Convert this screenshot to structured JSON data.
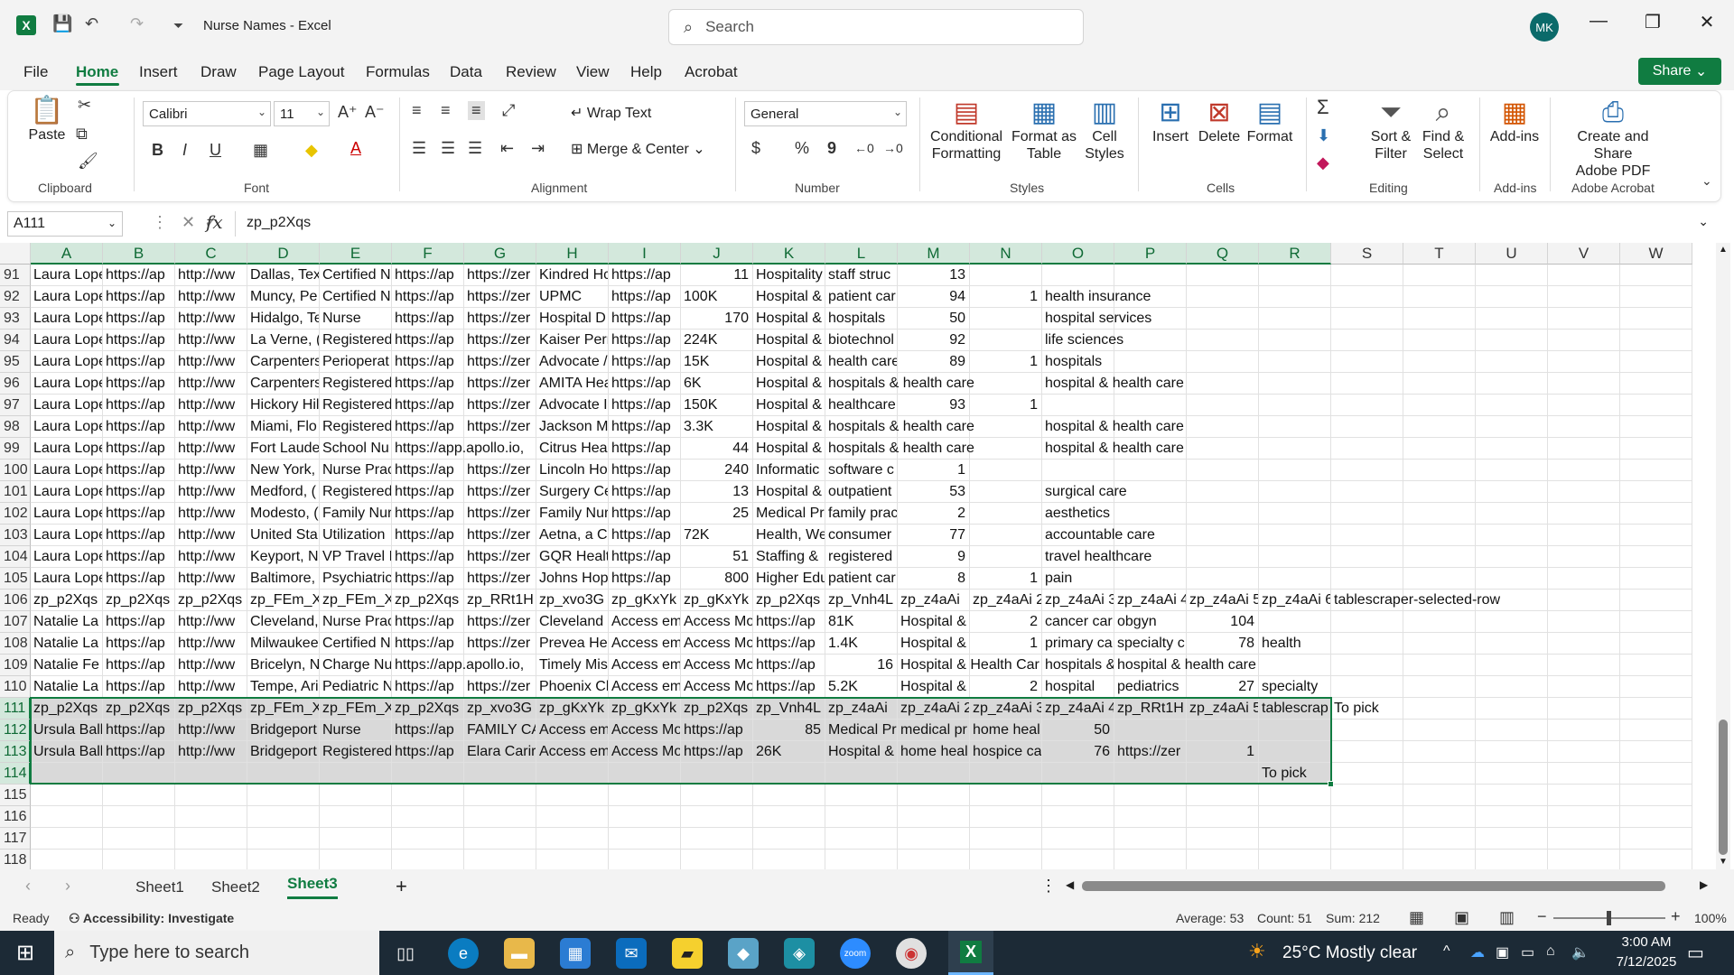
{
  "window": {
    "title": "Nurse Names  -  Excel",
    "search_placeholder": "Search",
    "user_initials": "MK",
    "minimize": "—",
    "restore": "❐",
    "close": "✕"
  },
  "menu": [
    "File",
    "Home",
    "Insert",
    "Draw",
    "Page Layout",
    "Formulas",
    "Data",
    "Review",
    "View",
    "Help",
    "Acrobat"
  ],
  "share_label": "Share",
  "ribbon": {
    "clipboard": {
      "paste": "Paste",
      "group": "Clipboard"
    },
    "font": {
      "name": "Calibri",
      "size": "11",
      "group": "Font",
      "bold": "B",
      "italic": "I",
      "underline": "U"
    },
    "alignment": {
      "wrap": "Wrap Text",
      "merge": "Merge & Center",
      "group": "Alignment"
    },
    "number": {
      "format": "General",
      "group": "Number",
      "currency": "$",
      "percent": "%",
      "comma": "9"
    },
    "styles": {
      "conditional": "Conditional\nFormatting",
      "format_table": "Format as\nTable",
      "cell_styles": "Cell\nStyles",
      "group": "Styles"
    },
    "cells": {
      "insert": "Insert",
      "delete": "Delete",
      "format": "Format",
      "group": "Cells"
    },
    "editing": {
      "sort": "Sort &\nFilter",
      "find": "Find &\nSelect",
      "group": "Editing"
    },
    "addins": {
      "label": "Add-ins",
      "group": "Add-ins"
    },
    "acrobat": {
      "label": "Create and Share\nAdobe PDF",
      "group": "Adobe Acrobat"
    }
  },
  "formula_bar": {
    "name_box": "A111",
    "content": "zp_p2Xqs"
  },
  "columns": [
    "A",
    "B",
    "C",
    "D",
    "E",
    "F",
    "G",
    "H",
    "I",
    "J",
    "K",
    "L",
    "M",
    "N",
    "O",
    "P",
    "Q",
    "R",
    "S",
    "T",
    "U",
    "V",
    "W"
  ],
  "rows": [
    {
      "n": "91",
      "c": {
        "A": "Laura Lope",
        "B": "https://ap",
        "C": "http://ww",
        "D": "Dallas, Tex",
        "E": "Certified N",
        "F": "https://ap",
        "G": "https://zer",
        "H": "Kindred Hc",
        "I": "https://ap",
        "J": "11",
        "K": "Hospitality",
        "L": "staff struc",
        "M": "13"
      }
    },
    {
      "n": "92",
      "c": {
        "A": "Laura Lope",
        "B": "https://ap",
        "C": "http://ww",
        "D": "Muncy, Pe",
        "E": "Certified N",
        "F": "https://ap",
        "G": "https://zer",
        "H": "UPMC",
        "I": "https://ap",
        "J": "100K",
        "K": "Hospital &",
        "L": "patient car",
        "M": "94",
        "N": "1",
        "O": "health insurance"
      }
    },
    {
      "n": "93",
      "c": {
        "A": "Laura Lope",
        "B": "https://ap",
        "C": "http://ww",
        "D": "Hidalgo, Te",
        "E": "Nurse",
        "F": "https://ap",
        "G": "https://zer",
        "H": "Hospital D",
        "I": "https://ap",
        "J": "170",
        "K": "Hospital &",
        "L": "hospitals",
        "M": "50",
        "O": "hospital services"
      }
    },
    {
      "n": "94",
      "c": {
        "A": "Laura Lope",
        "B": "https://ap",
        "C": "http://ww",
        "D": "La Verne, (",
        "E": "Registered",
        "F": "https://ap",
        "G": "https://zer",
        "H": "Kaiser Perr",
        "I": "https://ap",
        "J": "224K",
        "K": "Hospital &",
        "L": "biotechnol",
        "M": "92",
        "O": "life sciences"
      }
    },
    {
      "n": "95",
      "c": {
        "A": "Laura Lope",
        "B": "https://ap",
        "C": "http://ww",
        "D": "Carpenters",
        "E": "Perioperat",
        "F": "https://ap",
        "G": "https://zer",
        "H": "Advocate /",
        "I": "https://ap",
        "J": "15K",
        "K": "Hospital &",
        "L": "health care",
        "M": "89",
        "N": "1",
        "O": "hospitals"
      }
    },
    {
      "n": "96",
      "c": {
        "A": "Laura Lope",
        "B": "https://ap",
        "C": "http://ww",
        "D": "Carpenters",
        "E": "Registered",
        "F": "https://ap",
        "G": "https://zer",
        "H": "AMITA Hea",
        "I": "https://ap",
        "J": "6K",
        "K": "Hospital &",
        "L": "hospitals & health care",
        "O": "hospital & health care"
      }
    },
    {
      "n": "97",
      "c": {
        "A": "Laura Lope",
        "B": "https://ap",
        "C": "http://ww",
        "D": "Hickory Hil",
        "E": "Registered",
        "F": "https://ap",
        "G": "https://zer",
        "H": "Advocate I",
        "I": "https://ap",
        "J": "150K",
        "K": "Hospital &",
        "L": "healthcare",
        "M": "93",
        "N": "1"
      }
    },
    {
      "n": "98",
      "c": {
        "A": "Laura Lope",
        "B": "https://ap",
        "C": "http://ww",
        "D": "Miami, Flo",
        "E": "Registered",
        "F": "https://ap",
        "G": "https://zer",
        "H": "Jackson M",
        "I": "https://ap",
        "J": "3.3K",
        "K": "Hospital &",
        "L": "hospitals & health care",
        "O": "hospital & health care"
      }
    },
    {
      "n": "99",
      "c": {
        "A": "Laura Lope",
        "B": "https://ap",
        "C": "http://ww",
        "D": "Fort Laude",
        "E": "School Nu",
        "F": "https://app.apollo.io,",
        "H": "Citrus Hea",
        "I": "https://ap",
        "J": "44",
        "K": "Hospital &",
        "L": "hospitals & health care",
        "O": "hospital & health care"
      }
    },
    {
      "n": "100",
      "c": {
        "A": "Laura Lope",
        "B": "https://ap",
        "C": "http://ww",
        "D": "New York,",
        "E": "Nurse Prac",
        "F": "https://ap",
        "G": "https://zer",
        "H": "Lincoln Ho",
        "I": "https://ap",
        "J": "240",
        "K": "Informatic",
        "L": "software c",
        "M": "1"
      }
    },
    {
      "n": "101",
      "c": {
        "A": "Laura Lope",
        "B": "https://ap",
        "C": "http://ww",
        "D": "Medford, (",
        "E": "Registered",
        "F": "https://ap",
        "G": "https://zer",
        "H": "Surgery Ce",
        "I": "https://ap",
        "J": "13",
        "K": "Hospital &",
        "L": "outpatient",
        "M": "53",
        "O": "surgical care"
      }
    },
    {
      "n": "102",
      "c": {
        "A": "Laura Lope",
        "B": "https://ap",
        "C": "http://ww",
        "D": "Modesto, (",
        "E": "Family Nur",
        "F": "https://ap",
        "G": "https://zer",
        "H": "Family Nur",
        "I": "https://ap",
        "J": "25",
        "K": "Medical Pr",
        "L": "family prac",
        "M": "2",
        "O": "aesthetics"
      }
    },
    {
      "n": "103",
      "c": {
        "A": "Laura Lope",
        "B": "https://ap",
        "C": "http://ww",
        "D": "United Sta",
        "E": "Utilization",
        "F": "https://ap",
        "G": "https://zer",
        "H": "Aetna, a C",
        "I": "https://ap",
        "J": "72K",
        "K": "Health, We",
        "L": "consumer",
        "M": "77",
        "O": "accountable care"
      }
    },
    {
      "n": "104",
      "c": {
        "A": "Laura Lope",
        "B": "https://ap",
        "C": "http://ww",
        "D": "Keyport, N",
        "E": "VP Travel I",
        "F": "https://ap",
        "G": "https://zer",
        "H": "GQR Healt",
        "I": "https://ap",
        "J": "51",
        "K": "Staffing &",
        "L": "registered",
        "M": "9",
        "O": "travel healthcare"
      }
    },
    {
      "n": "105",
      "c": {
        "A": "Laura Lope",
        "B": "https://ap",
        "C": "http://ww",
        "D": "Baltimore,",
        "E": "Psychiatric",
        "F": "https://ap",
        "G": "https://zer",
        "H": "Johns Hop",
        "I": "https://ap",
        "J": "800",
        "K": "Higher Edu",
        "L": "patient car",
        "M": "8",
        "N": "1",
        "O": "pain"
      }
    },
    {
      "n": "106",
      "c": {
        "A": "zp_p2Xqs",
        "B": "zp_p2Xqs",
        "C": "zp_p2Xqs",
        "D": "zp_FEm_X",
        "E": "zp_FEm_X",
        "F": "zp_p2Xqs",
        "G": "zp_RRt1H",
        "H": "zp_xvo3G",
        "I": "zp_gKxYk",
        "J": "zp_gKxYk 2",
        "K": "zp_p2Xqs",
        "L": "zp_Vnh4L",
        "M": "zp_z4aAi",
        "N": "zp_z4aAi 2",
        "O": "zp_z4aAi 3",
        "P": "zp_z4aAi 4",
        "Q": "zp_z4aAi 5",
        "R": "zp_z4aAi 6",
        "S": "tablescraper-selected-row"
      }
    },
    {
      "n": "107",
      "c": {
        "A": "Natalie La",
        "B": "https://ap",
        "C": "http://ww",
        "D": "Cleveland,",
        "E": "Nurse Prac",
        "F": "https://ap",
        "G": "https://zer",
        "H": "Cleveland",
        "I": "Access em",
        "J": "Access Mo",
        "K": "https://ap",
        "L": "81K",
        "M": "Hospital &",
        "N": "2",
        "O": "cancer car",
        "P": "obgyn",
        "Q": "104"
      }
    },
    {
      "n": "108",
      "c": {
        "A": "Natalie La",
        "B": "https://ap",
        "C": "http://ww",
        "D": "Milwaukee",
        "E": "Certified N",
        "F": "https://ap",
        "G": "https://zer",
        "H": "Prevea He",
        "I": "Access em",
        "J": "Access Mo",
        "K": "https://ap",
        "L": "1.4K",
        "M": "Hospital &",
        "N": "1",
        "O": "primary ca",
        "P": "specialty c",
        "Q": "78",
        "R": "health"
      }
    },
    {
      "n": "109",
      "c": {
        "A": "Natalie Fe",
        "B": "https://ap",
        "C": "http://ww",
        "D": "Bricelyn, N",
        "E": "Charge Nu",
        "F": "https://app.apollo.io,",
        "H": "Timely Mis",
        "I": "Access em",
        "J": "Access Mo",
        "K": "https://ap",
        "L": "16",
        "M": "Hospital & Health Car",
        "O": "hospitals &",
        "P": "hospital & health care"
      }
    },
    {
      "n": "110",
      "c": {
        "A": "Natalie La",
        "B": "https://ap",
        "C": "http://ww",
        "D": "Tempe, Ari",
        "E": "Pediatric N",
        "F": "https://ap",
        "G": "https://zer",
        "H": "Phoenix Cl",
        "I": "Access em",
        "J": "Access Mo",
        "K": "https://ap",
        "L": "5.2K",
        "M": "Hospital &",
        "N": "2",
        "O": "hospital",
        "P": "pediatrics",
        "Q": "27",
        "R": "specialty"
      }
    },
    {
      "n": "111",
      "c": {
        "A": "zp_p2Xqs",
        "B": "zp_p2Xqs",
        "C": "zp_p2Xqs",
        "D": "zp_FEm_X",
        "E": "zp_FEm_X",
        "F": "zp_p2Xqs",
        "G": "zp_xvo3G",
        "H": "zp_gKxYk",
        "I": "zp_gKxYk 2",
        "J": "zp_p2Xqs",
        "K": "zp_Vnh4L",
        "L": "zp_z4aAi",
        "M": "zp_z4aAi 2",
        "N": "zp_z4aAi 3",
        "O": "zp_z4aAi 4",
        "P": "zp_RRt1H",
        "Q": "zp_z4aAi 5",
        "R": "tablescrap",
        "S": "To pick"
      }
    },
    {
      "n": "112",
      "c": {
        "A": "Ursula Ball",
        "B": "https://ap",
        "C": "http://ww",
        "D": "Bridgeport",
        "E": "Nurse",
        "F": "https://ap",
        "G": "FAMILY CA",
        "H": "Access em",
        "I": "Access Mo",
        "J": "https://ap",
        "K": "85",
        "L": "Medical Pr",
        "M": "medical pr",
        "N": "home heal",
        "O": "50"
      }
    },
    {
      "n": "113",
      "c": {
        "A": "Ursula Ball",
        "B": "https://ap",
        "C": "http://ww",
        "D": "Bridgeport",
        "E": "Registered",
        "F": "https://ap",
        "G": "Elara Carir",
        "H": "Access em",
        "I": "Access Mo",
        "J": "https://ap",
        "K": "26K",
        "L": "Hospital &",
        "M": "home heal",
        "N": "hospice ca",
        "O": "76",
        "P": "https://zer",
        "Q": "1"
      }
    },
    {
      "n": "114",
      "c": {
        "R": "To pick"
      }
    },
    {
      "n": "115",
      "c": {}
    },
    {
      "n": "116",
      "c": {}
    },
    {
      "n": "117",
      "c": {}
    },
    {
      "n": "118",
      "c": {}
    }
  ],
  "sheets": [
    "Sheet1",
    "Sheet2",
    "Sheet3"
  ],
  "active_sheet": "Sheet3",
  "add_sheet": "+",
  "status": {
    "ready": "Ready",
    "accessibility": "Accessibility: Investigate",
    "average": "Average: 53",
    "count": "Count: 51",
    "sum": "Sum: 212",
    "zoom": "100%"
  },
  "taskbar": {
    "search_placeholder": "Type here to search",
    "weather": "25°C  Mostly clear",
    "time": "3:00 AM",
    "date": "7/12/2025"
  },
  "colors": {
    "accent": "#107c41",
    "selection_fill": "#d9d9d9",
    "taskbar": "#1c2a36"
  }
}
